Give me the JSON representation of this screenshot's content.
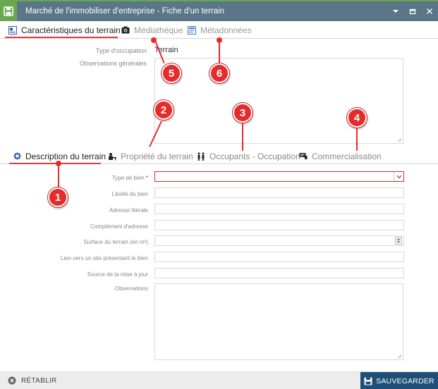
{
  "window": {
    "title": "Marché de l'immobiliser d'entreprise - Fiche d'un terrain"
  },
  "top_tabs": [
    {
      "label": "Caractéristiques du terrain",
      "icon": "id-card-icon",
      "active": true
    },
    {
      "label": "Médiathèque",
      "icon": "camera-icon",
      "active": false
    },
    {
      "label": "Métadonnées",
      "icon": "document-icon",
      "active": false
    }
  ],
  "general": {
    "type_label": "Type d'occupation",
    "type_value": "Terrain",
    "observations_label": "Observations générales"
  },
  "sub_tabs": [
    {
      "label": "Description du terrain",
      "icon": "gear-icon",
      "active": true
    },
    {
      "label": "Propriété du terrain",
      "icon": "person-desk-icon",
      "active": false
    },
    {
      "label": "Occupants - Occupation",
      "icon": "people-icon",
      "active": false
    },
    {
      "label": "Commercialisation",
      "icon": "sign-icon",
      "active": false
    }
  ],
  "form": {
    "type_bien": "Type de bien",
    "required_mark": "*",
    "libelle": "Libellé du bien",
    "adresse": "Adresse litérale",
    "complement": "Complément d'adresse",
    "surface": "Surface du terrain (en m²)",
    "lien": "Lien vers un site présentant le bien",
    "source": "Source de la mise à jour",
    "observations": "Observations"
  },
  "footer": {
    "reset_label": "RÉTABLIR",
    "save_label": "SAUVEGARDER"
  },
  "callouts": [
    "1",
    "2",
    "3",
    "4",
    "5",
    "6"
  ],
  "colors": {
    "titlebar": "#5a7688",
    "app_icon": "#6aa84f",
    "accent": "#e03c3c",
    "save_button": "#1f4e79",
    "callout": "#e52b2b"
  }
}
